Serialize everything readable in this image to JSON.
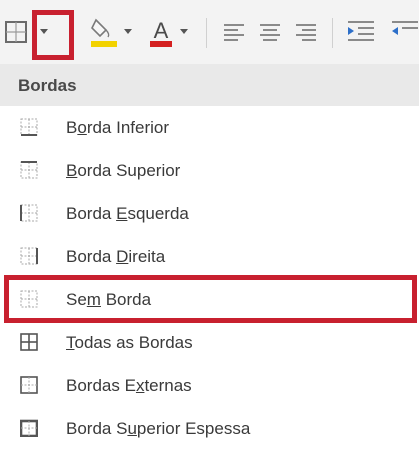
{
  "menu": {
    "title": "Bordas",
    "items": [
      {
        "pre": "B",
        "accel": "o",
        "post": "rda Inferior",
        "icon": "border-bottom-icon"
      },
      {
        "pre": "",
        "accel": "B",
        "post": "orda Superior",
        "icon": "border-top-icon"
      },
      {
        "pre": "Borda ",
        "accel": "E",
        "post": "squerda",
        "icon": "border-left-icon"
      },
      {
        "pre": "Borda ",
        "accel": "D",
        "post": "ireita",
        "icon": "border-right-icon"
      },
      {
        "pre": "Se",
        "accel": "m",
        "post": " Borda",
        "icon": "no-border-icon"
      },
      {
        "pre": "",
        "accel": "T",
        "post": "odas as Bordas",
        "icon": "all-borders-icon"
      },
      {
        "pre": "Bordas E",
        "accel": "x",
        "post": "ternas",
        "icon": "outside-borders-icon"
      },
      {
        "pre": "Borda S",
        "accel": "u",
        "post": "perior Espessa",
        "icon": "thick-top-border-icon"
      }
    ]
  },
  "colors": {
    "highlight": "#c8202f",
    "fill_swatch": "#f2d200",
    "font_swatch": "#d42020",
    "header_bg": "#e9e9e9"
  },
  "toolbar": {
    "icons": [
      "borders-icon",
      "borders-dropdown-arrow-icon",
      "fill-color-icon",
      "font-color-icon",
      "align-left-icon",
      "align-center-icon",
      "align-right-icon",
      "indent-icon"
    ]
  }
}
